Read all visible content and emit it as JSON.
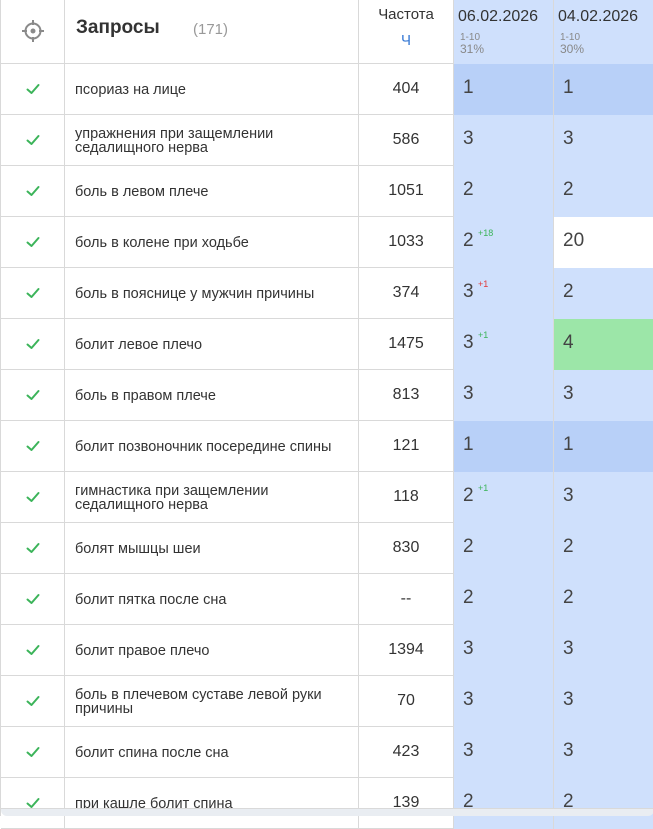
{
  "header": {
    "queries_title": "Запросы",
    "queries_count": "(171)",
    "frequency_title": "Частота",
    "frequency_sort": "Ч",
    "dates": [
      {
        "date": "06.02.2026",
        "range": "1-10",
        "percent": "31%"
      },
      {
        "date": "04.02.2026",
        "range": "1-10",
        "percent": "30%"
      }
    ]
  },
  "colors": {
    "check": "#3cb45a",
    "cell_dark": "#b8d0f8",
    "cell_light": "#cfe0fc",
    "cell_green": "#9ce6a8",
    "delta_up": "#3cb45a",
    "delta_down": "#e03a3a",
    "accent": "#3a7bd5"
  },
  "rows": [
    {
      "query": "псориаз на лице",
      "freq": "404",
      "d1": {
        "pos": "1",
        "delta": "",
        "dir": "",
        "bg": "dark"
      },
      "d2": {
        "pos": "1",
        "bg": "dark"
      }
    },
    {
      "query": "упражнения при защемлении седалищного нерва",
      "freq": "586",
      "d1": {
        "pos": "3",
        "delta": "",
        "dir": "",
        "bg": "light"
      },
      "d2": {
        "pos": "3",
        "bg": "light"
      }
    },
    {
      "query": "боль в левом плече",
      "freq": "1051",
      "d1": {
        "pos": "2",
        "delta": "",
        "dir": "",
        "bg": "light"
      },
      "d2": {
        "pos": "2",
        "bg": "light"
      }
    },
    {
      "query": "боль в колене при ходьбе",
      "freq": "1033",
      "d1": {
        "pos": "2",
        "delta": "+18",
        "dir": "up",
        "bg": "light"
      },
      "d2": {
        "pos": "20",
        "bg": "white"
      }
    },
    {
      "query": "боль в пояснице у мужчин причины",
      "freq": "374",
      "d1": {
        "pos": "3",
        "delta": "+1",
        "dir": "down",
        "bg": "light"
      },
      "d2": {
        "pos": "2",
        "bg": "light"
      }
    },
    {
      "query": "болит левое плечо",
      "freq": "1475",
      "d1": {
        "pos": "3",
        "delta": "+1",
        "dir": "up",
        "bg": "light"
      },
      "d2": {
        "pos": "4",
        "bg": "green"
      }
    },
    {
      "query": "боль в правом плече",
      "freq": "813",
      "d1": {
        "pos": "3",
        "delta": "",
        "dir": "",
        "bg": "light"
      },
      "d2": {
        "pos": "3",
        "bg": "light"
      }
    },
    {
      "query": "болит позвоночник посередине спины",
      "freq": "121",
      "d1": {
        "pos": "1",
        "delta": "",
        "dir": "",
        "bg": "dark"
      },
      "d2": {
        "pos": "1",
        "bg": "dark"
      }
    },
    {
      "query": "гимнастика при защемлении седалищного нерва",
      "freq": "118",
      "d1": {
        "pos": "2",
        "delta": "+1",
        "dir": "up",
        "bg": "light"
      },
      "d2": {
        "pos": "3",
        "bg": "light"
      }
    },
    {
      "query": "болят мышцы шеи",
      "freq": "830",
      "d1": {
        "pos": "2",
        "delta": "",
        "dir": "",
        "bg": "light"
      },
      "d2": {
        "pos": "2",
        "bg": "light"
      }
    },
    {
      "query": "болит пятка после сна",
      "freq": "--",
      "d1": {
        "pos": "2",
        "delta": "",
        "dir": "",
        "bg": "light"
      },
      "d2": {
        "pos": "2",
        "bg": "light"
      }
    },
    {
      "query": "болит правое плечо",
      "freq": "1394",
      "d1": {
        "pos": "3",
        "delta": "",
        "dir": "",
        "bg": "light"
      },
      "d2": {
        "pos": "3",
        "bg": "light"
      }
    },
    {
      "query": "боль в плечевом суставе левой руки причины",
      "freq": "70",
      "d1": {
        "pos": "3",
        "delta": "",
        "dir": "",
        "bg": "light"
      },
      "d2": {
        "pos": "3",
        "bg": "light"
      }
    },
    {
      "query": "болит спина после сна",
      "freq": "423",
      "d1": {
        "pos": "3",
        "delta": "",
        "dir": "",
        "bg": "light"
      },
      "d2": {
        "pos": "3",
        "bg": "light"
      }
    },
    {
      "query": "при кашле болит спина",
      "freq": "139",
      "d1": {
        "pos": "2",
        "delta": "",
        "dir": "",
        "bg": "light"
      },
      "d2": {
        "pos": "2",
        "bg": "light"
      }
    }
  ]
}
